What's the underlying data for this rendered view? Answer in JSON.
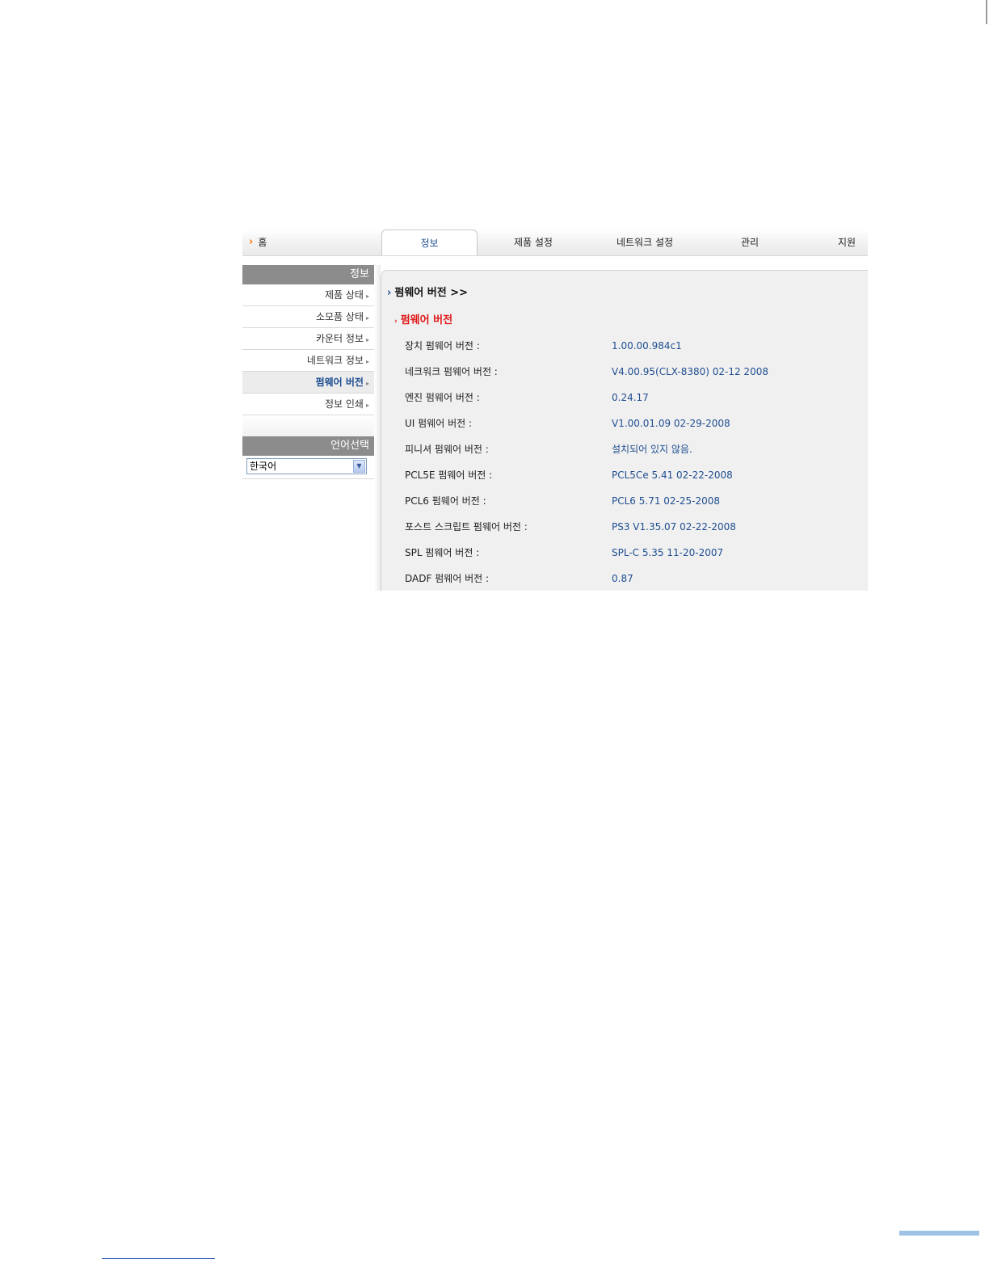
{
  "nav": {
    "home_label": "홈",
    "tabs": [
      "정보",
      "제품 설정",
      "네트워크 설정",
      "관리",
      "지원"
    ],
    "active_tab": "정보"
  },
  "sidebar": {
    "header": "정보",
    "items": [
      "제품 상태",
      "소모품 상태",
      "카운터 정보",
      "네트워크 정보",
      "펌웨어 버전",
      "정보 인쇄"
    ],
    "active_item": "펌웨어 버전",
    "language_header": "언어선택",
    "language_value": "한국어"
  },
  "content": {
    "title": "펌웨어 버전 >>",
    "section": "펌웨어 버전",
    "rows": [
      {
        "label": "장치 펌웨어 버전 :",
        "value": "1.00.00.984c1"
      },
      {
        "label": "네크워크 펌웨어 버전 :",
        "value": "V4.00.95(CLX-8380) 02-12 2008"
      },
      {
        "label": "엔진 펌웨어 버전 :",
        "value": "0.24.17"
      },
      {
        "label": "UI 펌웨어 버전 :",
        "value": "V1.00.01.09 02-29-2008"
      },
      {
        "label": "피니셔 펌웨어 버전 :",
        "value": "설치되어 있지 않음."
      },
      {
        "label": "PCL5E 펌웨어 버전 :",
        "value": "PCL5Ce 5.41 02-22-2008"
      },
      {
        "label": "PCL6 펌웨어 버전 :",
        "value": "PCL6 5.71 02-25-2008"
      },
      {
        "label": "포스트 스크립트 펌웨어 버전 :",
        "value": "PS3 V1.35.07 02-22-2008"
      },
      {
        "label": "SPL 펌웨어 버전 :",
        "value": "SPL-C 5.35 11-20-2007"
      },
      {
        "label": "DADF 펌웨어 버전 :",
        "value": "0.87"
      }
    ]
  },
  "colors": {
    "accent": "#1f4e91",
    "section_red": "#e01919",
    "home_arrow": "#ff7a00",
    "sidebar_header": "#8c8c8c"
  }
}
